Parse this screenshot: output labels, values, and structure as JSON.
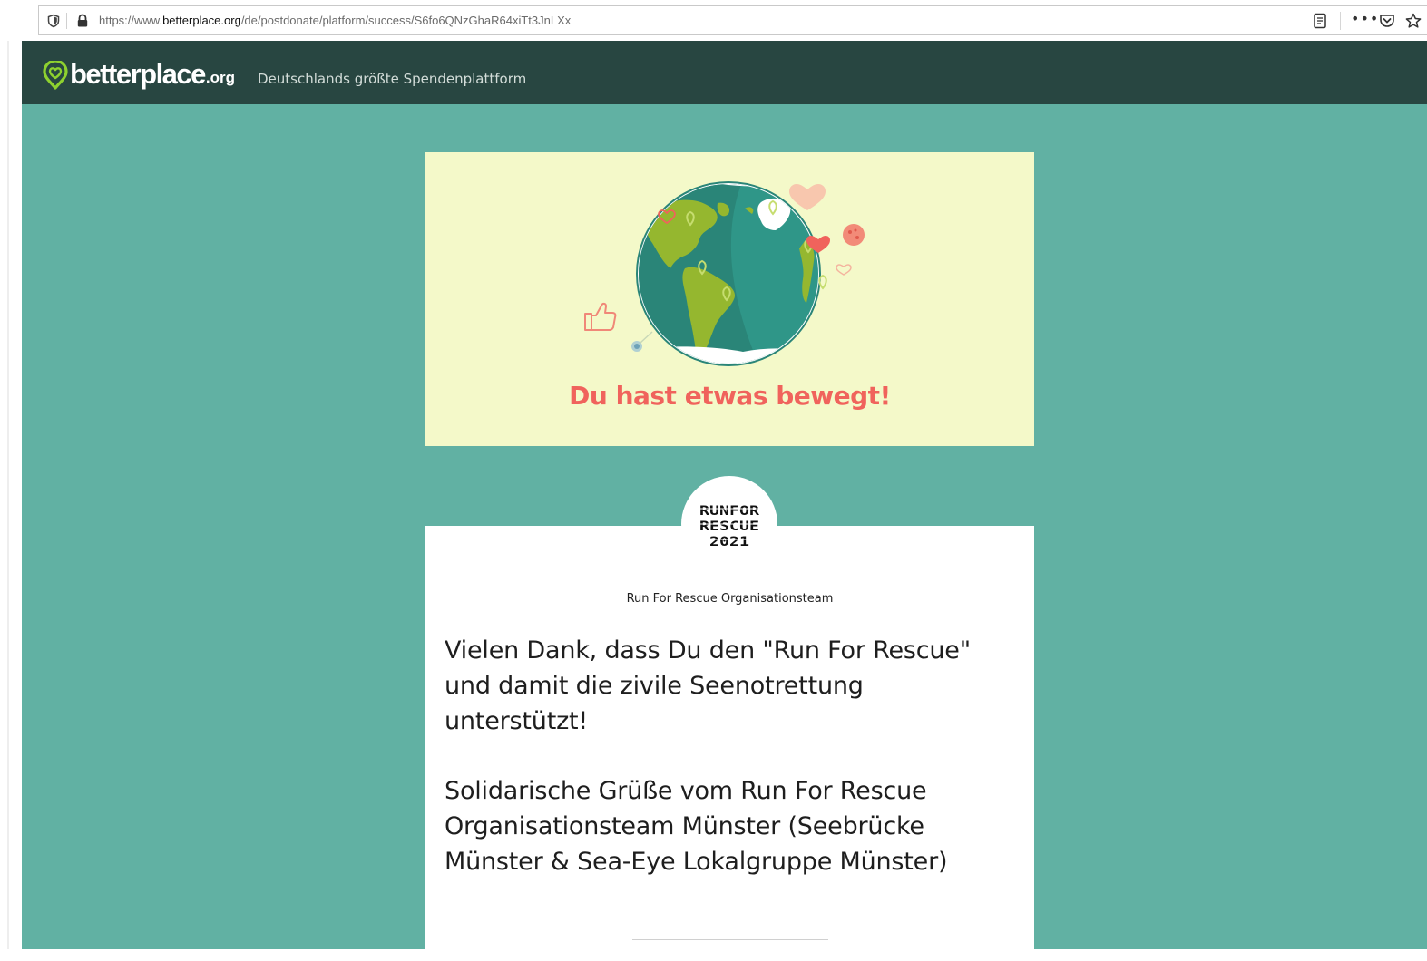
{
  "browser": {
    "url_prefix": "https://www.",
    "url_domain": "betterplace.org",
    "url_path": "/de/postdonate/platform/success/S6fo6QNzGhaR64xiTt3JnLXx"
  },
  "header": {
    "logo_name": "betterplace",
    "logo_tld": ".org",
    "tagline": "Deutschlands größte Spendenplattform"
  },
  "success": {
    "title": "Du hast etwas bewegt!"
  },
  "message": {
    "avatar_text": [
      "RUNFOR",
      "RESCUE",
      "2021"
    ],
    "org_name": "Run For Rescue Organisationsteam",
    "paragraphs": [
      "Vielen Dank, dass Du den \"Run For Rescue\" und damit die zivile Seenotrettung unterstützt!",
      "Solidarische Grüße vom Run For Rescue Organisationsteam Münster (Seebrücke Münster & Sea-Eye Lokalgruppe Münster)"
    ]
  },
  "colors": {
    "header_bg": "#284641",
    "page_bg": "#61b1a3",
    "success_bg": "#f4f9c9",
    "accent_red": "#f0635c",
    "globe_ocean": "#2f9688",
    "land_green": "#95b72f"
  }
}
